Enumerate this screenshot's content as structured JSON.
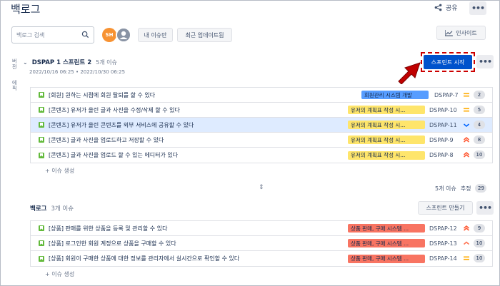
{
  "page": {
    "title": "백로그"
  },
  "header": {
    "share_label": "공유",
    "more_label": "•••",
    "insight_label": "인사이트"
  },
  "toolbar": {
    "search_placeholder": "백로그 검색",
    "avatar_initials": "SH",
    "filter_mine": "내 이슈만",
    "filter_recent": "최근 업데이트됨"
  },
  "sidebar": {
    "label1": "버전",
    "label2": "에픽"
  },
  "sprint": {
    "name": "DSPAP 1 스프린트 2",
    "count": "5개 이슈",
    "dates": "2022/10/16 06:25 • 2022/10/30 06:25",
    "start_label": "스프린트 시작",
    "more_label": "•••",
    "create_label": "+ 이슈 생성",
    "issues": [
      {
        "summary": "[회원] 원하는 시점에 회원 탈퇴를 할 수 있다",
        "epic": "회원관리 시스템 개발",
        "epic_color": "#579dff",
        "key": "DSPAP-7",
        "priority": "medium",
        "estimate": "2"
      },
      {
        "summary": "[콘텐츠] 유저가 올린 글과 사진을 수정/삭제 할 수 있다",
        "epic": "유저의 계획표 작성 시...",
        "epic_color": "#fee56b",
        "key": "DSPAP-10",
        "priority": "medium",
        "estimate": "5"
      },
      {
        "summary": "[콘텐츠] 유저가 올린 콘텐츠를 외부 서비스에 공유할 수 있다",
        "epic": "유저의 계획표 작성 시...",
        "epic_color": "#fee56b",
        "key": "DSPAP-11",
        "priority": "low",
        "estimate": "4"
      },
      {
        "summary": "[콘텐츠] 글과 사진을 업로드하고 저장할 수 있다",
        "epic": "유저의 계획표 작성 시...",
        "epic_color": "#fee56b",
        "key": "DSPAP-9",
        "priority": "highest",
        "estimate": "8"
      },
      {
        "summary": "[콘텐츠] 글과 사진을 업로드 할 수 있는 에디터가 있다",
        "epic": "유저의 계획표 작성 시...",
        "epic_color": "#fee56b",
        "key": "DSPAP-8",
        "priority": "highest",
        "estimate": "10"
      }
    ]
  },
  "sprint_summary": {
    "count": "5개 이슈",
    "estimate_label": "추정",
    "estimate_total": "29"
  },
  "backlog": {
    "name": "백로그",
    "count": "3개 이슈",
    "create_sprint_label": "스프린트 만들기",
    "more_label": "•••",
    "create_label": "+ 이슈 생성",
    "issues": [
      {
        "summary": "[상품] 판매를 위한 상품을 등록 및 관리할 수 있다",
        "epic": "상품 판매, 구매 시스템 ...",
        "epic_color": "#f87462",
        "key": "DSPAP-12",
        "priority": "highest",
        "estimate": "9"
      },
      {
        "summary": "[상품] 로그인한 회원 계정으로 상품을 구매할 수 있다",
        "epic": "상품 판매, 구매 시스템 ...",
        "epic_color": "#f87462",
        "key": "DSPAP-13",
        "priority": "high",
        "estimate": "10"
      },
      {
        "summary": "[상품] 회원이 구매한 상품에 대한 정보를 관리자에서 실시간으로 확인할 수 있다",
        "epic": "상품 판매, 구매 시스템 ...",
        "epic_color": "#f87462",
        "key": "DSPAP-14",
        "priority": "medium",
        "estimate": "10"
      }
    ]
  },
  "colors": {
    "primary": "#0052cc",
    "highlight_border": "#cc0000",
    "arrow": "#c00000",
    "story_icon": "#63ba3c"
  }
}
